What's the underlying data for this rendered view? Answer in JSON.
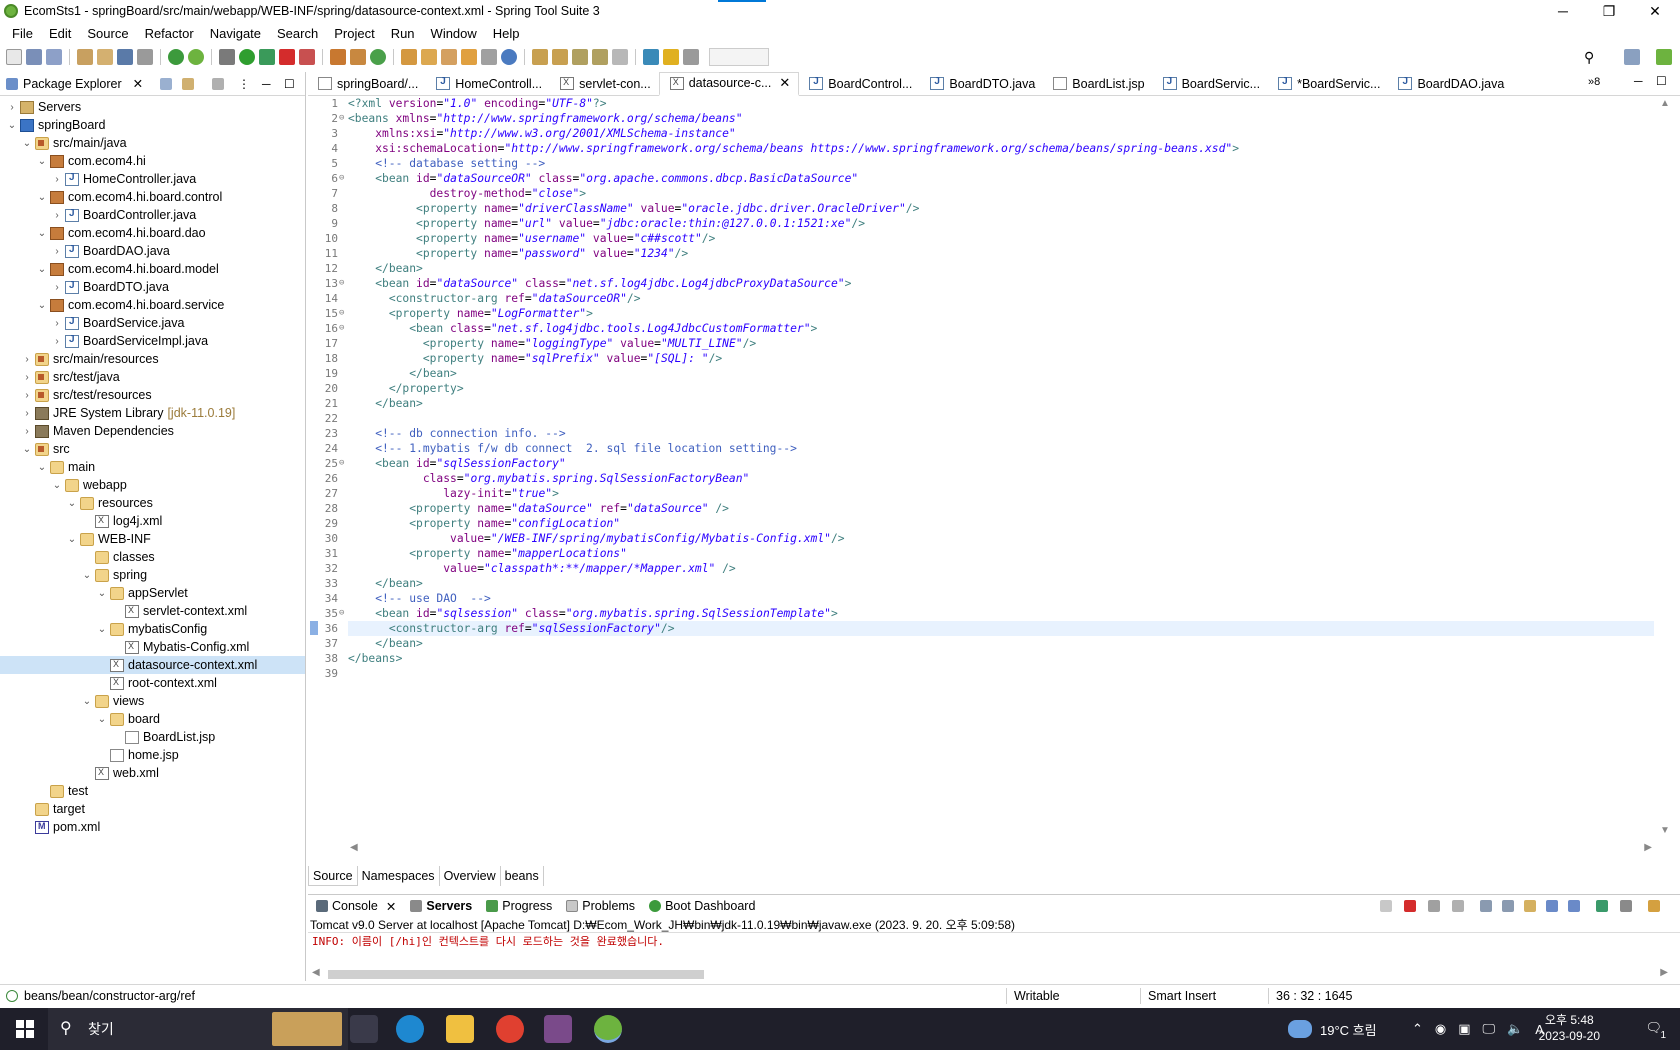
{
  "window": {
    "title": "EcomSts1 - springBoard/src/main/webapp/WEB-INF/spring/datasource-context.xml - Spring Tool Suite 3",
    "controls": {
      "minimize": "─",
      "maximize": "❐",
      "close": "✕"
    }
  },
  "menu": [
    "File",
    "Edit",
    "Source",
    "Refactor",
    "Navigate",
    "Search",
    "Project",
    "Run",
    "Window",
    "Help"
  ],
  "explorer": {
    "title": "Package Explorer",
    "items": [
      {
        "label": "Servers",
        "indent": 0,
        "twisty": "›",
        "icon": "server"
      },
      {
        "label": "springBoard",
        "indent": 0,
        "twisty": "⌄",
        "icon": "proj"
      },
      {
        "label": "src/main/java",
        "indent": 1,
        "twisty": "⌄",
        "icon": "srcfolder"
      },
      {
        "label": "com.ecom4.hi",
        "indent": 2,
        "twisty": "⌄",
        "icon": "pkg"
      },
      {
        "label": "HomeController.java",
        "indent": 3,
        "twisty": "›",
        "icon": "java"
      },
      {
        "label": "com.ecom4.hi.board.control",
        "indent": 2,
        "twisty": "⌄",
        "icon": "pkg"
      },
      {
        "label": "BoardController.java",
        "indent": 3,
        "twisty": "›",
        "icon": "java"
      },
      {
        "label": "com.ecom4.hi.board.dao",
        "indent": 2,
        "twisty": "⌄",
        "icon": "pkg"
      },
      {
        "label": "BoardDAO.java",
        "indent": 3,
        "twisty": "›",
        "icon": "java"
      },
      {
        "label": "com.ecom4.hi.board.model",
        "indent": 2,
        "twisty": "⌄",
        "icon": "pkg"
      },
      {
        "label": "BoardDTO.java",
        "indent": 3,
        "twisty": "›",
        "icon": "java"
      },
      {
        "label": "com.ecom4.hi.board.service",
        "indent": 2,
        "twisty": "⌄",
        "icon": "pkg"
      },
      {
        "label": "BoardService.java",
        "indent": 3,
        "twisty": "›",
        "icon": "java"
      },
      {
        "label": "BoardServiceImpl.java",
        "indent": 3,
        "twisty": "›",
        "icon": "java"
      },
      {
        "label": "src/main/resources",
        "indent": 1,
        "twisty": "›",
        "icon": "srcfolder"
      },
      {
        "label": "src/test/java",
        "indent": 1,
        "twisty": "›",
        "icon": "srcfolder"
      },
      {
        "label": "src/test/resources",
        "indent": 1,
        "twisty": "›",
        "icon": "srcfolder"
      },
      {
        "label": "JRE System Library",
        "indent": 1,
        "twisty": "›",
        "icon": "lib",
        "suffix": "[jdk-11.0.19]"
      },
      {
        "label": "Maven Dependencies",
        "indent": 1,
        "twisty": "›",
        "icon": "lib"
      },
      {
        "label": "src",
        "indent": 1,
        "twisty": "⌄",
        "icon": "srcfolder"
      },
      {
        "label": "main",
        "indent": 2,
        "twisty": "⌄",
        "icon": "folder"
      },
      {
        "label": "webapp",
        "indent": 3,
        "twisty": "⌄",
        "icon": "folder"
      },
      {
        "label": "resources",
        "indent": 4,
        "twisty": "⌄",
        "icon": "folder"
      },
      {
        "label": "log4j.xml",
        "indent": 5,
        "twisty": "",
        "icon": "xml"
      },
      {
        "label": "WEB-INF",
        "indent": 4,
        "twisty": "⌄",
        "icon": "folder"
      },
      {
        "label": "classes",
        "indent": 5,
        "twisty": "",
        "icon": "folder"
      },
      {
        "label": "spring",
        "indent": 5,
        "twisty": "⌄",
        "icon": "folder"
      },
      {
        "label": "appServlet",
        "indent": 6,
        "twisty": "⌄",
        "icon": "folder"
      },
      {
        "label": "servlet-context.xml",
        "indent": 7,
        "twisty": "",
        "icon": "xml"
      },
      {
        "label": "mybatisConfig",
        "indent": 6,
        "twisty": "⌄",
        "icon": "folder"
      },
      {
        "label": "Mybatis-Config.xml",
        "indent": 7,
        "twisty": "",
        "icon": "xml"
      },
      {
        "label": "datasource-context.xml",
        "indent": 6,
        "twisty": "",
        "icon": "xml",
        "selected": true
      },
      {
        "label": "root-context.xml",
        "indent": 6,
        "twisty": "",
        "icon": "xml"
      },
      {
        "label": "views",
        "indent": 5,
        "twisty": "⌄",
        "icon": "folder"
      },
      {
        "label": "board",
        "indent": 6,
        "twisty": "⌄",
        "icon": "folder"
      },
      {
        "label": "BoardList.jsp",
        "indent": 7,
        "twisty": "",
        "icon": "jsp"
      },
      {
        "label": "home.jsp",
        "indent": 6,
        "twisty": "",
        "icon": "jsp"
      },
      {
        "label": "web.xml",
        "indent": 5,
        "twisty": "",
        "icon": "xml"
      },
      {
        "label": "test",
        "indent": 2,
        "twisty": "",
        "icon": "folder"
      },
      {
        "label": "target",
        "indent": 1,
        "twisty": "",
        "icon": "folder"
      },
      {
        "label": "pom.xml",
        "indent": 1,
        "twisty": "",
        "icon": "pom"
      }
    ]
  },
  "editor_tabs": [
    {
      "label": "springBoard/...",
      "icon": "jsp"
    },
    {
      "label": "HomeControll...",
      "icon": "java"
    },
    {
      "label": "servlet-con...",
      "icon": "xml"
    },
    {
      "label": "datasource-c...",
      "icon": "xml",
      "active": true
    },
    {
      "label": "BoardControl...",
      "icon": "java"
    },
    {
      "label": "BoardDTO.java",
      "icon": "java"
    },
    {
      "label": "BoardList.jsp",
      "icon": "jsp"
    },
    {
      "label": "BoardServic...",
      "icon": "java"
    },
    {
      "label": "*BoardServic...",
      "icon": "java"
    },
    {
      "label": "BoardDAO.java",
      "icon": "java"
    }
  ],
  "editor_overflow": "»8",
  "code_lines": [
    "<?xml version=\"1.0\" encoding=\"UTF-8\"?>",
    "<beans xmlns=\"http://www.springframework.org/schema/beans\"",
    "    xmlns:xsi=\"http://www.w3.org/2001/XMLSchema-instance\"",
    "    xsi:schemaLocation=\"http://www.springframework.org/schema/beans https://www.springframework.org/schema/beans/spring-beans.xsd\">",
    "    <!-- database setting -->",
    "    <bean id=\"dataSourceOR\" class=\"org.apache.commons.dbcp.BasicDataSource\"",
    "            destroy-method=\"close\">",
    "          <property name=\"driverClassName\" value=\"oracle.jdbc.driver.OracleDriver\"/>",
    "          <property name=\"url\" value=\"jdbc:oracle:thin:@127.0.0.1:1521:xe\"/>",
    "          <property name=\"username\" value=\"c##scott\"/>",
    "          <property name=\"password\" value=\"1234\"/>",
    "    </bean>",
    "    <bean id=\"dataSource\" class=\"net.sf.log4jdbc.Log4jdbcProxyDataSource\">",
    "      <constructor-arg ref=\"dataSourceOR\"/>",
    "      <property name=\"LogFormatter\">",
    "         <bean class=\"net.sf.log4jdbc.tools.Log4JdbcCustomFormatter\">",
    "           <property name=\"loggingType\" value=\"MULTI_LINE\"/>",
    "           <property name=\"sqlPrefix\" value=\"[SQL]: \"/>",
    "         </bean>",
    "      </property>",
    "    </bean>",
    "",
    "    <!-- db connection info. -->",
    "    <!-- 1.mybatis f/w db connect  2. sql file location setting-->",
    "    <bean id=\"sqlSessionFactory\"",
    "           class=\"org.mybatis.spring.SqlSessionFactoryBean\"",
    "              lazy-init=\"true\">",
    "         <property name=\"dataSource\" ref=\"dataSource\" />",
    "         <property name=\"configLocation\"",
    "               value=\"/WEB-INF/spring/mybatisConfig/Mybatis-Config.xml\"/>",
    "         <property name=\"mapperLocations\"",
    "              value=\"classpath*:**/mapper/*Mapper.xml\" />",
    "    </bean>",
    "    <!-- use DAO  -->",
    "    <bean id=\"sqlsession\" class=\"org.mybatis.spring.SqlSessionTemplate\">",
    "      <constructor-arg ref=\"sqlSessionFactory\"/>",
    "    </bean>",
    "</beans>",
    ""
  ],
  "editor_bottom_tabs": [
    "Source",
    "Namespaces",
    "Overview",
    "beans"
  ],
  "console": {
    "tabs": [
      "Console",
      "Servers",
      "Progress",
      "Problems",
      "Boot Dashboard"
    ],
    "server_line": "Tomcat v9.0 Server at localhost [Apache Tomcat] D:₩Ecom_Work_JH₩bin₩jdk-11.0.19₩bin₩javaw.exe  (2023. 9. 20. 오후 5:09:58)",
    "info_line": "INFO: 이름이 [/hi]인 컨텍스트를 다시 로드하는 것을 완료했습니다."
  },
  "status": {
    "path": "beans/bean/constructor-arg/ref",
    "writable": "Writable",
    "insert_mode": "Smart Insert",
    "position": "36 : 32 : 1645"
  },
  "taskbar": {
    "search_placeholder": "찾기",
    "weather": "19°C 흐림",
    "ime": "A",
    "time": "오후 5:48",
    "date": "2023-09-20",
    "notifications": "1"
  }
}
